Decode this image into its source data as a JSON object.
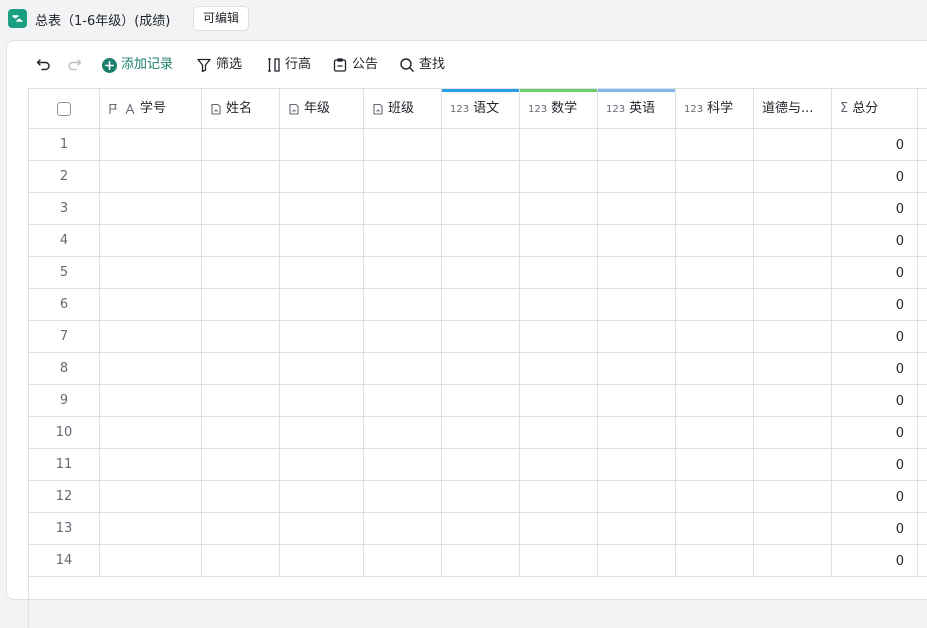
{
  "app": {
    "title": "总表（1-6年级）(成绩)",
    "edit_badge": "可编辑",
    "logo_icon": "table-app-icon"
  },
  "toolbar": {
    "undo_icon": "undo-icon",
    "redo_icon": "redo-icon",
    "add_record": "添加记录",
    "filter": "筛选",
    "row_height": "行高",
    "announcement": "公告",
    "search": "查找"
  },
  "columns": [
    {
      "key": "select",
      "label": "",
      "type": "checkbox"
    },
    {
      "key": "xuehao",
      "label": "学号",
      "type": "text-primary"
    },
    {
      "key": "xingming",
      "label": "姓名",
      "type": "lookup"
    },
    {
      "key": "nianji",
      "label": "年级",
      "type": "lookup"
    },
    {
      "key": "banji",
      "label": "班级",
      "type": "lookup"
    },
    {
      "key": "yuwen",
      "label": "语文",
      "type": "number",
      "accent": "#2b9ee8"
    },
    {
      "key": "shuxue",
      "label": "数学",
      "type": "number",
      "accent": "#6bcf6b"
    },
    {
      "key": "yingyu",
      "label": "英语",
      "type": "number",
      "accent": "#7fb6ec"
    },
    {
      "key": "kexue",
      "label": "科学",
      "type": "number"
    },
    {
      "key": "daode",
      "label": "道德与...",
      "type": "text"
    },
    {
      "key": "zongfen",
      "label": "总分",
      "type": "formula"
    }
  ],
  "type_marks": {
    "number": "123",
    "formula": "Σ"
  },
  "rows": [
    {
      "num": "1",
      "total": "0"
    },
    {
      "num": "2",
      "total": "0"
    },
    {
      "num": "3",
      "total": "0"
    },
    {
      "num": "4",
      "total": "0"
    },
    {
      "num": "5",
      "total": "0"
    },
    {
      "num": "6",
      "total": "0"
    },
    {
      "num": "7",
      "total": "0"
    },
    {
      "num": "8",
      "total": "0"
    },
    {
      "num": "9",
      "total": "0"
    },
    {
      "num": "10",
      "total": "0"
    },
    {
      "num": "11",
      "total": "0"
    },
    {
      "num": "12",
      "total": "0"
    },
    {
      "num": "13",
      "total": "0"
    },
    {
      "num": "14",
      "total": "0"
    }
  ],
  "colors": {
    "accent": "#1a7f6b",
    "border": "#dee0e3"
  }
}
